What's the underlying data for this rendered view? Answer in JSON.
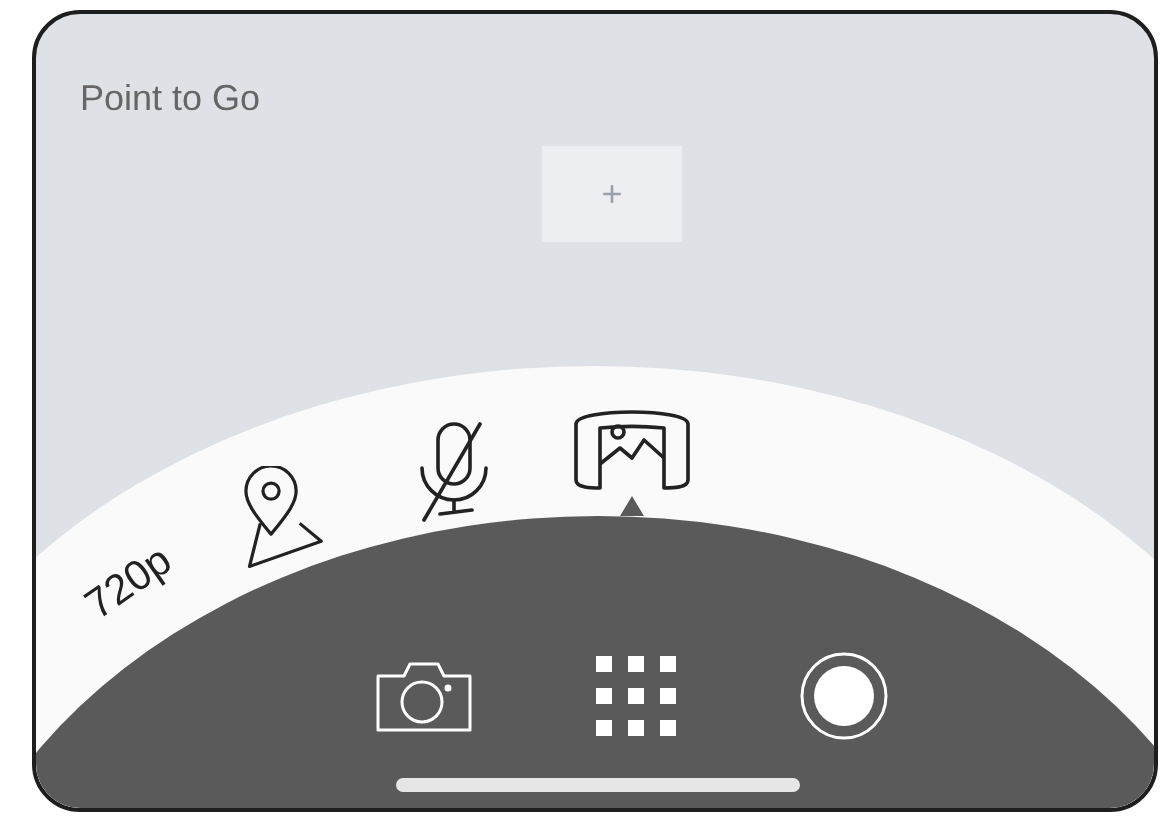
{
  "title": "Point to Go",
  "add_button": "+",
  "options": [
    {
      "kind": "text",
      "label": "720p",
      "selected": false
    },
    {
      "kind": "location",
      "selected": false
    },
    {
      "kind": "mic-off",
      "selected": false
    },
    {
      "kind": "panorama",
      "selected": true
    }
  ],
  "controls": [
    {
      "kind": "camera"
    },
    {
      "kind": "grid"
    },
    {
      "kind": "record"
    }
  ]
}
